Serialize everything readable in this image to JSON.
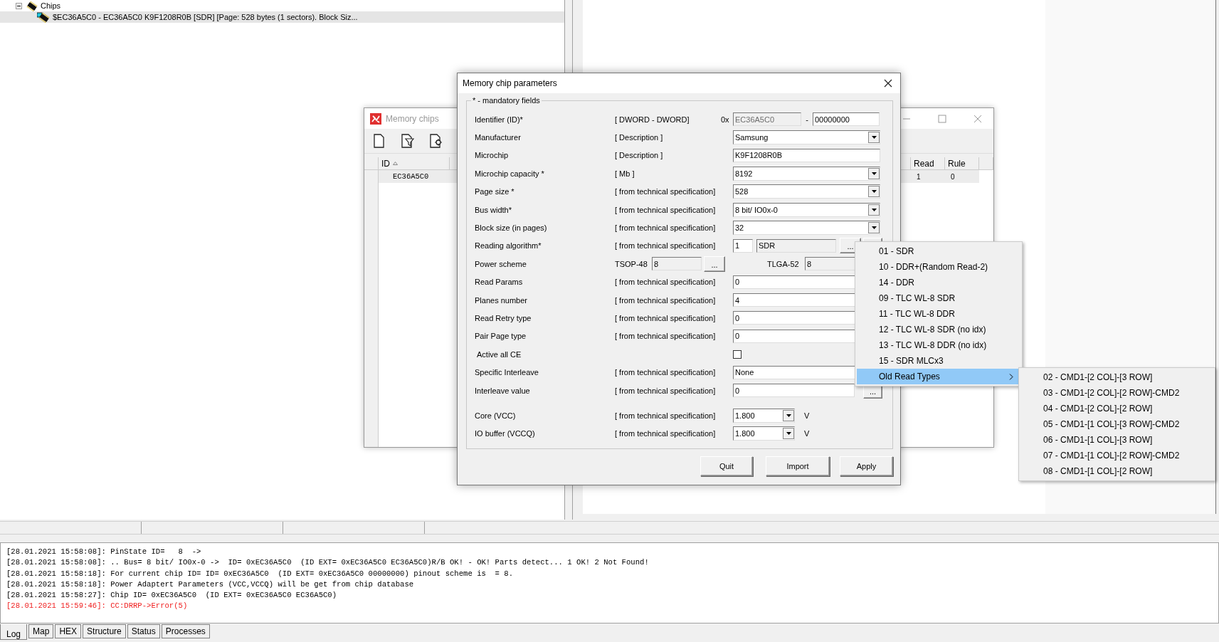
{
  "tree": {
    "label": "Chips",
    "expanded": true,
    "children": [
      {
        "label": "$EC36A5C0 -  EC36A5C0 K9F1208R0B [SDR] [Page: 528 bytes (1 sectors). Block Siz...",
        "selected": true
      }
    ]
  },
  "memory_chips_window": {
    "title": "Memory chips",
    "columns": [
      {
        "label": "ID",
        "sorted": true
      },
      {
        "label": "Read",
        "sorted": false
      },
      {
        "label": "Rule",
        "sorted": false
      }
    ],
    "rows": [
      {
        "cells": [
          "EC36A5C0",
          "1",
          "0"
        ],
        "selected": true
      }
    ]
  },
  "dialog": {
    "title": "Memory chip parameters",
    "legend": "* - mandatory fields",
    "rows": [
      {
        "kind": "id",
        "label": "Identifier (ID)*",
        "hint": "[ DWORD - DWORD]",
        "prefix": "0x",
        "separator": "-",
        "fields": [
          {
            "value": "EC36A5C0",
            "disabled": true
          },
          {
            "value": "00000000",
            "disabled": false
          }
        ]
      },
      {
        "kind": "combo",
        "label": "Manufacturer",
        "hint": "[ Description ]",
        "value": "Samsung"
      },
      {
        "kind": "text",
        "label": "Microchip",
        "hint": "[ Description ]",
        "value": "K9F1208R0B"
      },
      {
        "kind": "combo",
        "label": "Microchip capacity *",
        "hint": "[ Mb ]",
        "value": "8192"
      },
      {
        "kind": "combo",
        "label": "Page size *",
        "hint": "[ from technical specification]",
        "value": "528"
      },
      {
        "kind": "combo",
        "label": "Bus width*",
        "hint": "[ from technical specification]",
        "value": "8 bit/ IO0x-0"
      },
      {
        "kind": "combo",
        "label": "Block size (in pages)",
        "hint": "[ from technical specification]",
        "value": "32"
      },
      {
        "kind": "algorithm",
        "label": "Reading algorithm*",
        "hint": "[ from technical specification]",
        "fields": [
          {
            "value": "1",
            "disabled": false
          },
          {
            "value": "SDR",
            "disabled": true
          }
        ],
        "button": "..."
      },
      {
        "kind": "power",
        "label": "Power scheme",
        "packages": [
          {
            "label": "TSOP-48",
            "value": "8",
            "button": "..."
          },
          {
            "label": "TLGA-52",
            "value": "8"
          }
        ]
      },
      {
        "kind": "text",
        "label": "Read Params",
        "hint": "[ from technical specification]",
        "value": "0"
      },
      {
        "kind": "text",
        "label": "Planes number",
        "hint": "[ from technical specification]",
        "value": "4"
      },
      {
        "kind": "text",
        "label": "Read Retry type",
        "hint": "[ from technical specification]",
        "value": "0"
      },
      {
        "kind": "text",
        "label": "Pair Page type",
        "hint": "[ from technical specification]",
        "value": "0"
      },
      {
        "kind": "checkbox",
        "label": "Active all CE",
        "checked": false
      },
      {
        "kind": "text",
        "label": "Specific Interleave",
        "hint": "[ from technical specification]",
        "value": "None"
      },
      {
        "kind": "text",
        "label": "Interleave value",
        "hint": "[ from technical specification]",
        "value": "0",
        "button": "..."
      },
      {
        "kind": "voltage",
        "label": "Core (VCC)",
        "hint": "[ from technical specification]",
        "value": "1.800",
        "unit": "V"
      },
      {
        "kind": "voltage",
        "label": "IO buffer (VCCQ)",
        "hint": "[ from technical specification]",
        "value": "1.800",
        "unit": "V"
      }
    ],
    "buttons": [
      "Quit",
      "Import",
      "Apply"
    ]
  },
  "menu": [
    {
      "label": "01 - SDR",
      "selected": false
    },
    {
      "label": "10 - DDR+(Random Read-2)",
      "selected": false
    },
    {
      "label": "14 - DDR",
      "selected": false
    },
    {
      "label": "09 - TLC WL-8 SDR",
      "selected": false
    },
    {
      "label": "11 - TLC WL-8 DDR",
      "selected": false
    },
    {
      "label": "12 - TLC WL-8 SDR (no idx)",
      "selected": false
    },
    {
      "label": "13 - TLC WL-8 DDR (no idx)",
      "selected": false
    },
    {
      "label": "15 - SDR MLCx3",
      "selected": false
    },
    {
      "label": "Old Read Types",
      "selected": true,
      "submenu": [
        {
          "label": "02 - CMD1-[2 COL]-[3 ROW]",
          "selected": false
        },
        {
          "label": "03 - CMD1-[2 COL]-[2 ROW]-CMD2",
          "selected": false
        },
        {
          "label": "04 - CMD1-[2 COL]-[2 ROW]",
          "selected": false
        },
        {
          "label": "05 - CMD1-[1 COL]-[3 ROW]-CMD2",
          "selected": false
        },
        {
          "label": "06 - CMD1-[1 COL]-[3 ROW]",
          "selected": false
        },
        {
          "label": "07 - CMD1-[1 COL]-[2 ROW]-CMD2",
          "selected": false
        },
        {
          "label": "08 - CMD1-[1 COL]-[2 ROW]",
          "selected": false
        }
      ]
    }
  ],
  "log": [
    {
      "kind": "info",
      "text": "[28.01.2021 15:58:08]: PinState ID=   8  ->"
    },
    {
      "kind": "info",
      "text": "[28.01.2021 15:58:08]: .. Bus= 8 bit/ IO0x-0 ->  ID= 0xEC36A5C0  (ID EXT= 0xEC36A5C0 EC36A5C0)R/B OK! - OK! Parts detect... 1 OK! 2 Not Found!"
    },
    {
      "kind": "info",
      "text": "[28.01.2021 15:58:18]: For current chip ID= ID= 0xEC36A5C0  (ID EXT= 0xEC36A5C0 00000000) pinout scheme is  = 8."
    },
    {
      "kind": "info",
      "text": "[28.01.2021 15:58:18]: Power Adaptert Parameters (VCC,VCCQ) will be get from chip database"
    },
    {
      "kind": "info",
      "text": "[28.01.2021 15:58:27]: Chip ID= 0xEC36A5C0  (ID EXT= 0xEC36A5C0 EC36A5C0)"
    },
    {
      "kind": "error",
      "text": "[28.01.2021 15:59:46]: CC:DRRP->Error(5)"
    }
  ],
  "bottom_tabs": [
    {
      "label": "Log",
      "selected": true
    },
    {
      "label": "Map",
      "selected": false
    },
    {
      "label": "HEX",
      "selected": false
    },
    {
      "label": "Structure",
      "selected": false
    },
    {
      "label": "Status",
      "selected": false
    },
    {
      "label": "Processes",
      "selected": false
    }
  ]
}
